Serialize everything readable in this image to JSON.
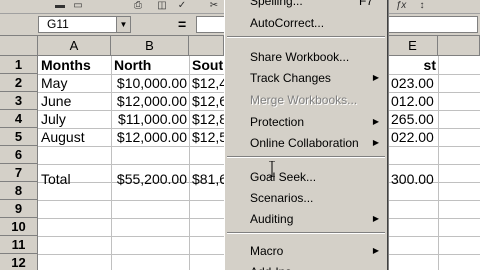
{
  "toolbar": {
    "icons": [
      "save-icon",
      "print-icon",
      "print-preview-icon",
      "spelling-icon",
      "cut-icon",
      "function-icon",
      "sort-icon"
    ]
  },
  "formula_bar": {
    "name_box": "G11",
    "equals": "=",
    "value": ""
  },
  "columns": [
    "A",
    "B",
    "E"
  ],
  "rows": [
    "1",
    "2",
    "3",
    "4",
    "5",
    "6",
    "7",
    "8",
    "9",
    "10",
    "11",
    "12"
  ],
  "sheet": {
    "headers": [
      "Months",
      "North",
      "Sout",
      "st"
    ],
    "data_rows": [
      {
        "month": "May",
        "north": "$10,000.00",
        "south": "$12,4",
        "east": "023.00"
      },
      {
        "month": "June",
        "north": "$12,000.00",
        "south": "$12,6",
        "east": "012.00"
      },
      {
        "month": "July",
        "north": "$11,000.00",
        "south": "$12,8",
        "east": "265.00"
      },
      {
        "month": "August",
        "north": "$12,000.00",
        "south": "$12,5",
        "east": "022.00"
      }
    ],
    "total": {
      "label": "Total",
      "north": "$55,200.00",
      "south": "$81,6",
      "east": "300.00"
    }
  },
  "menu": {
    "items": {
      "spelling": {
        "label": "Spelling...",
        "shortcut": "F7"
      },
      "autocorrect": "AutoCorrect...",
      "share": "Share Workbook...",
      "track": "Track Changes",
      "merge": "Merge Workbooks...",
      "protection": "Protection",
      "online": "Online Collaboration",
      "goalseek": "Goal Seek...",
      "scenarios": "Scenarios...",
      "auditing": "Auditing",
      "macro": "Macro",
      "addins": "Add-Ins..."
    }
  }
}
